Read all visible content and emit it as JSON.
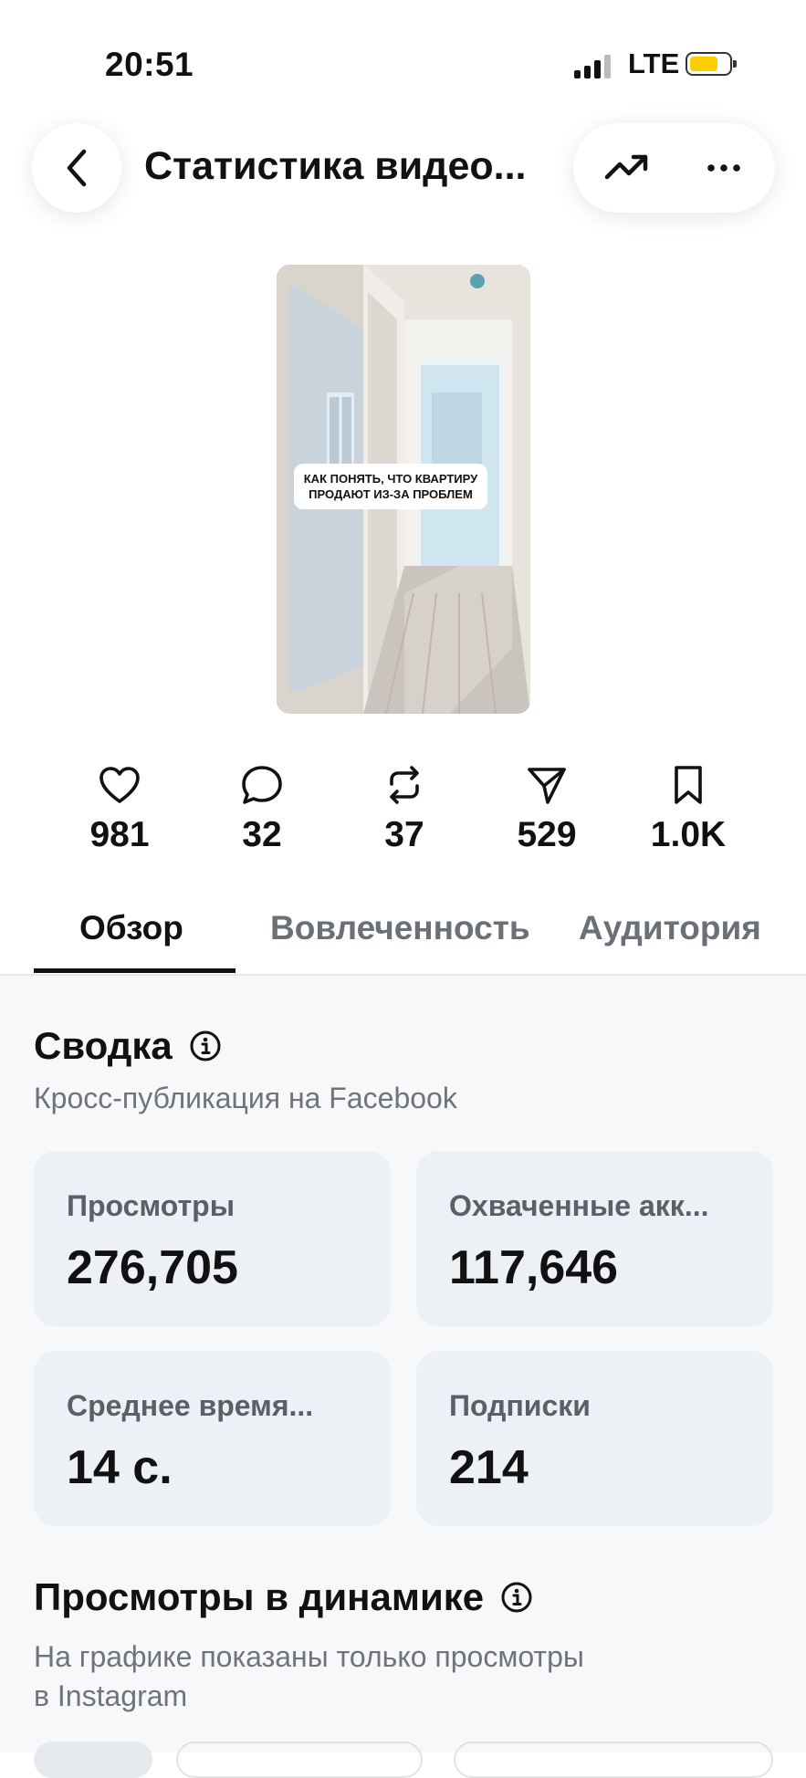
{
  "status_bar": {
    "time": "20:51",
    "network": "LTE",
    "battery_level": 0.75,
    "battery_color": "#FFCC00"
  },
  "header": {
    "title": "Статистика видео..."
  },
  "video": {
    "caption": "КАК ПОНЯТЬ, ЧТО КВАРТИРУ ПРОДАЮТ ИЗ-ЗА ПРОБЛЕМ"
  },
  "stats": [
    {
      "icon": "heart-icon",
      "value": "981"
    },
    {
      "icon": "comment-icon",
      "value": "32"
    },
    {
      "icon": "repost-icon",
      "value": "37"
    },
    {
      "icon": "share-icon",
      "value": "529"
    },
    {
      "icon": "bookmark-icon",
      "value": "1.0K"
    }
  ],
  "tabs": [
    {
      "label": "Обзор",
      "active": true
    },
    {
      "label": "Вовлеченность",
      "active": false
    },
    {
      "label": "Аудитория",
      "active": false
    }
  ],
  "summary": {
    "title": "Сводка",
    "subtitle": "Кросс-публикация на Facebook",
    "cards": [
      {
        "label": "Просмотры",
        "value": "276,705"
      },
      {
        "label": "Охваченные акк...",
        "value": "117,646"
      },
      {
        "label": "Среднее время...",
        "value": "14 с."
      },
      {
        "label": "Подписки",
        "value": "214"
      }
    ]
  },
  "views_dynamics": {
    "title": "Просмотры в динамике",
    "subtitle_line1": "На графике показаны только просмотры",
    "subtitle_line2": "в Instagram"
  }
}
